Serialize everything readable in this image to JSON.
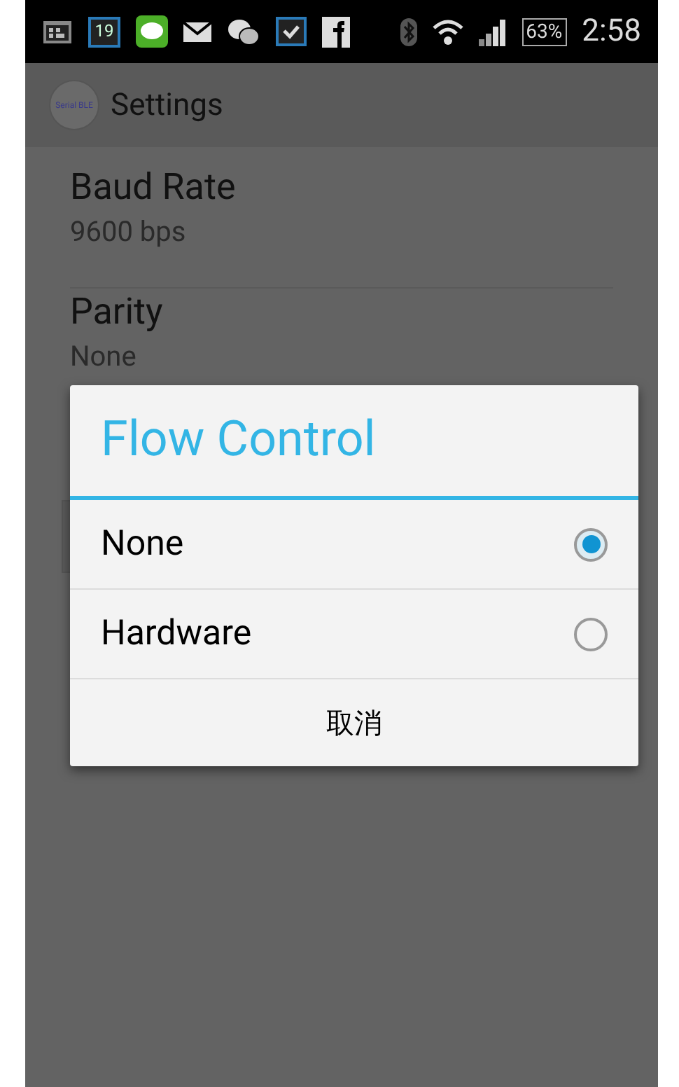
{
  "status_bar": {
    "calendar_day": "19",
    "battery": "63%",
    "time": "2:58"
  },
  "action_bar": {
    "logo_text": "Serial BLE",
    "title": "Settings"
  },
  "settings": [
    {
      "title": "Baud Rate",
      "summary": "9600 bps"
    },
    {
      "title": "Parity",
      "summary": "None"
    }
  ],
  "dialog": {
    "title": "Flow Control",
    "options": [
      {
        "label": "None",
        "selected": true
      },
      {
        "label": "Hardware",
        "selected": false
      }
    ],
    "cancel": "取消"
  }
}
